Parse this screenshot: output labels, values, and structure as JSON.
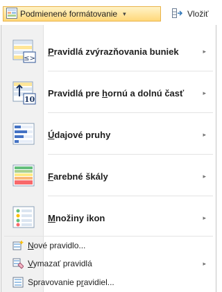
{
  "ribbon": {
    "conditional_formatting": {
      "label": "Podmienené formátovanie",
      "arrow": "▾"
    },
    "insert": {
      "label": "Vložiť"
    }
  },
  "menu": {
    "items": [
      {
        "label": "Pravidlá zvýrazňovania buniek",
        "icon": "highlight-cells-icon",
        "submenu": "▸",
        "accel_index": 0
      },
      {
        "label": "Pravidlá pre hornú a dolnú časť",
        "icon": "top-bottom-rules-icon",
        "submenu": "▸",
        "accel_index": 12
      },
      {
        "label": "Údajové pruhy",
        "icon": "data-bars-icon",
        "submenu": "▸",
        "accel_index": 0
      },
      {
        "label": "Farebné škály",
        "icon": "color-scales-icon",
        "submenu": "▸",
        "accel_index": 0
      },
      {
        "label": "Množiny ikon",
        "icon": "icon-sets-icon",
        "submenu": "▸",
        "accel_index": 0
      }
    ],
    "small_items": [
      {
        "label": "Nové pravidlo...",
        "icon": "new-rule-icon",
        "submenu": ""
      },
      {
        "label": "Vymazať pravidlá",
        "icon": "clear-rules-icon",
        "submenu": "▸"
      },
      {
        "label": "Spravovanie pravidiel...",
        "icon": "manage-rules-icon",
        "submenu": ""
      }
    ]
  }
}
